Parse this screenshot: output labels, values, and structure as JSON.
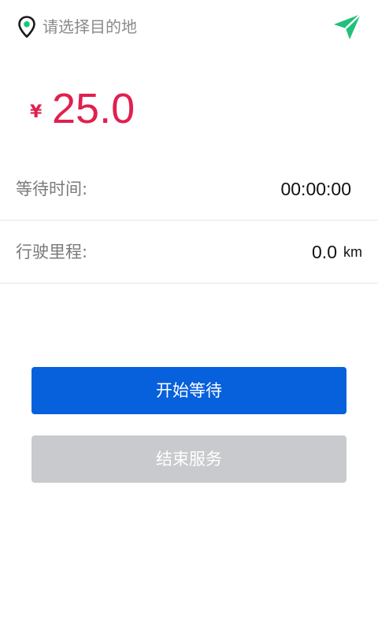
{
  "header": {
    "destination_placeholder": "请选择目的地",
    "location_icon": "map-pin-icon",
    "navigate_icon": "paper-plane-icon"
  },
  "fare": {
    "currency": "¥",
    "amount": "25.0"
  },
  "stats": {
    "wait_label": "等待时间:",
    "wait_value": "00:00:00",
    "distance_label": "行驶里程:",
    "distance_value": "0.0",
    "distance_unit": "km"
  },
  "actions": {
    "start_wait_label": "开始等待",
    "end_service_label": "结束服务"
  },
  "colors": {
    "accent": "#e0204e",
    "primary_button": "#0760dc",
    "disabled_button": "#c8cacd",
    "nav_icon": "#21c07b"
  }
}
